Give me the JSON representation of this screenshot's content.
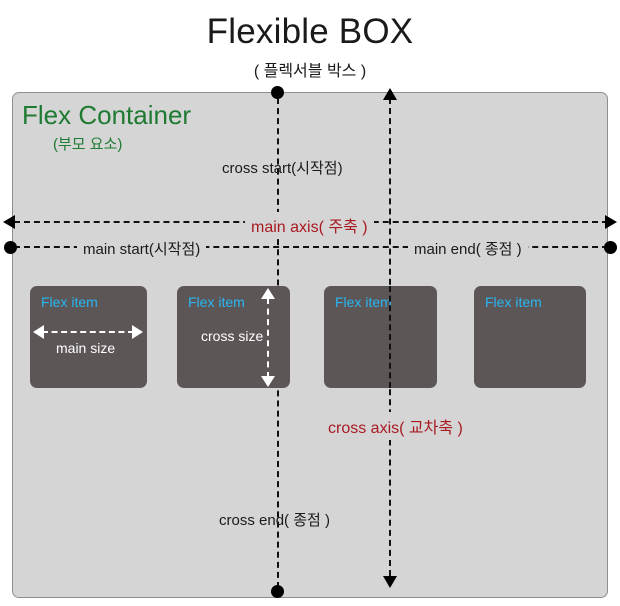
{
  "title": "Flexible BOX",
  "subtitle": "( 플렉서블 박스 )",
  "container": {
    "title": "Flex Container",
    "subtitle": "(부모 요소)"
  },
  "axes": {
    "cross_start": "cross start(시작점)",
    "main_axis": "main axis( 주축 )",
    "main_start": "main start(시작점)",
    "main_end": "main end( 종점 )",
    "cross_axis": "cross axis( 교차축 )",
    "cross_end": "cross end( 종점 )"
  },
  "items": [
    {
      "label": "Flex item",
      "size_label": "main size"
    },
    {
      "label": "Flex item",
      "size_label": "cross size"
    },
    {
      "label": "Flex item",
      "size_label": ""
    },
    {
      "label": "Flex item",
      "size_label": ""
    }
  ],
  "colors": {
    "page_bg": "#ffffff",
    "container_bg": "#d5d5d5",
    "container_border": "#8e8e8e",
    "container_title": "#1f7a32",
    "item_bg": "#5d5657",
    "item_label": "#29b6f0",
    "axis_label": "#a81a22",
    "text": "#1a1a1a",
    "line": "#111111",
    "measure_line": "#ffffff"
  }
}
